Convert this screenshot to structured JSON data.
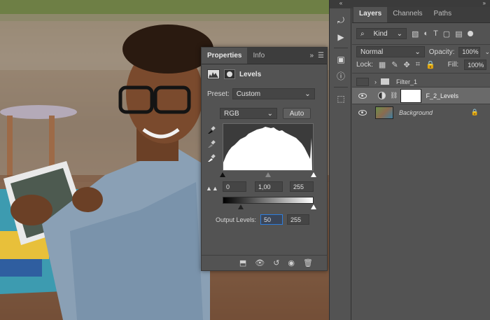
{
  "properties_panel": {
    "tabs": [
      "Properties",
      "Info"
    ],
    "menu_icon": "panel-menu-icon",
    "adjustment_title": "Levels",
    "preset_label": "Preset:",
    "preset_value": "Custom",
    "channel_value": "RGB",
    "auto_label": "Auto",
    "input_black": "0",
    "input_gamma": "1,00",
    "input_white": "255",
    "output_label": "Output Levels:",
    "output_black": "50",
    "output_white": "255"
  },
  "layers_panel": {
    "tabs": [
      "Layers",
      "Channels",
      "Paths"
    ],
    "filter_kind": "Kind",
    "blend_mode": "Normal",
    "opacity_label": "Opacity:",
    "opacity_value": "100%",
    "lock_label": "Lock:",
    "fill_label": "Fill:",
    "fill_value": "100%",
    "layers": [
      {
        "name": "Filter_1",
        "type": "group"
      },
      {
        "name": "F_2_Levels",
        "type": "adjustment"
      },
      {
        "name": "Background",
        "type": "image"
      }
    ]
  },
  "colors": {
    "panel_bg": "#535353",
    "tab_bar": "#3d3d3d",
    "selected_layer": "#6a6a6a",
    "focus_field": "#2d7ddd"
  }
}
